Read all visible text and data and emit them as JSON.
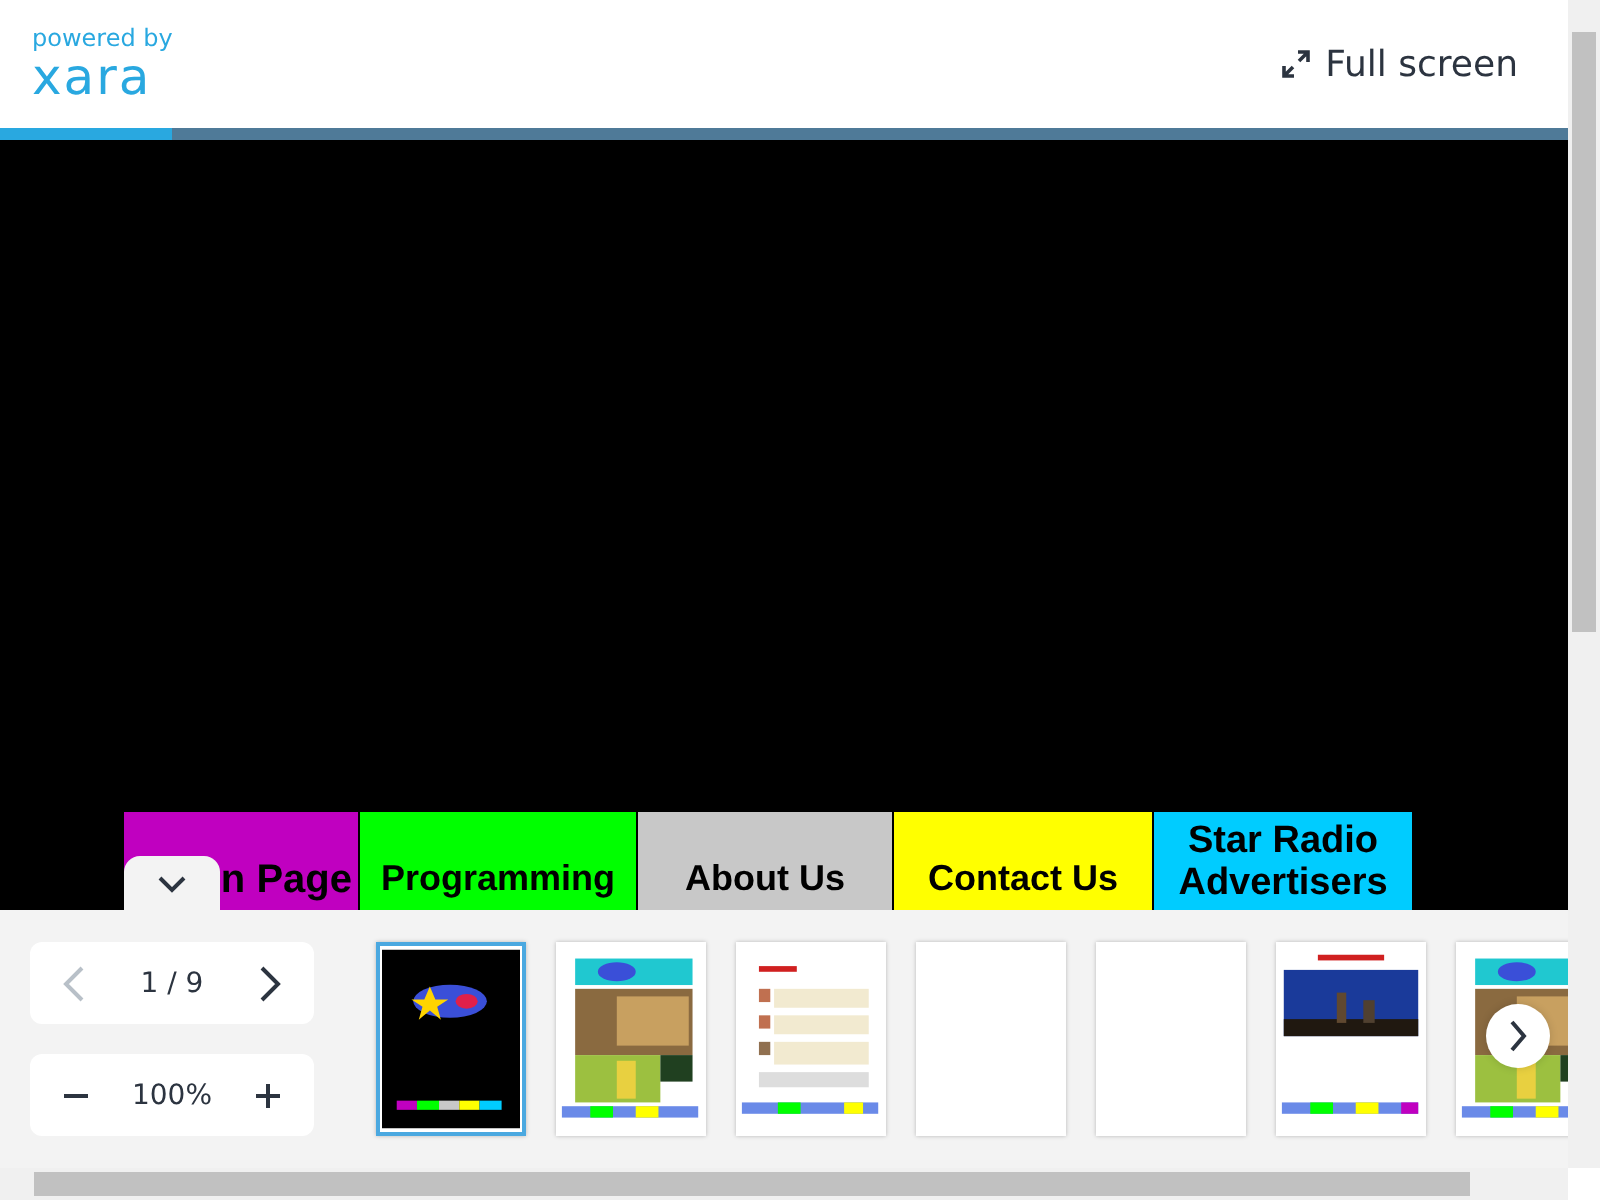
{
  "header": {
    "powered_by": "powered by",
    "logo": "xara",
    "fullscreen_button": "Full screen"
  },
  "progress": {
    "level": 0.11
  },
  "nav_buttons": [
    {
      "label": "n Page",
      "color": "#c000c0"
    },
    {
      "label": "Programming",
      "color": "#00ff00"
    },
    {
      "label": "About Us",
      "color": "#c8c8c8"
    },
    {
      "label": "Contact Us",
      "color": "#ffff00"
    },
    {
      "label": "Star Radio Advertisers",
      "color": "#00ccff"
    }
  ],
  "pager": {
    "prev_disabled": true,
    "page": "1 / 9",
    "next_disabled": false
  },
  "zoom": {
    "value": "100%"
  },
  "thumbnails": [
    {
      "kind": "dark",
      "selected": true
    },
    {
      "kind": "collage",
      "selected": false
    },
    {
      "kind": "text",
      "selected": false
    },
    {
      "kind": "blank",
      "selected": false
    },
    {
      "kind": "blank",
      "selected": false
    },
    {
      "kind": "city",
      "selected": false
    },
    {
      "kind": "collage",
      "selected": false
    }
  ]
}
